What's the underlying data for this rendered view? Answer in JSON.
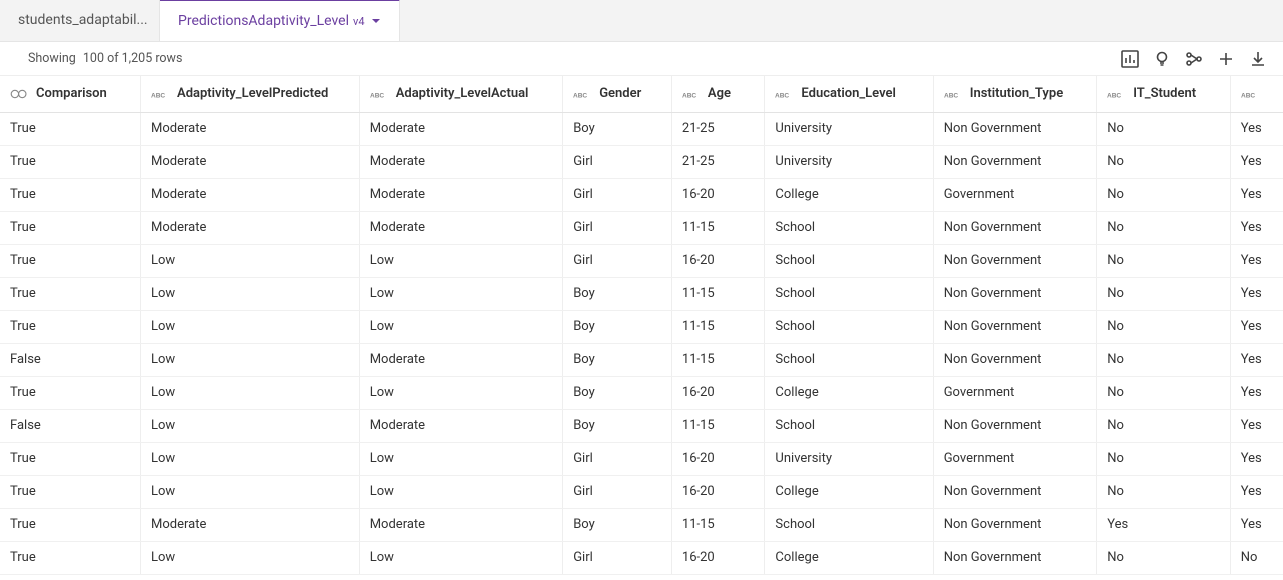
{
  "tabs": [
    {
      "label": "students_adaptabil...",
      "active": false
    },
    {
      "label": "PredictionsAdaptivity_Level",
      "version": "v4",
      "active": true
    }
  ],
  "status": {
    "showing": "Showing",
    "count": "100 of 1,205 rows"
  },
  "columns": [
    {
      "key": "Comparison",
      "label": "Comparison",
      "type": "bool"
    },
    {
      "key": "Adaptivity_LevelPredicted",
      "label": "Adaptivity_LevelPredicted",
      "type": "abc"
    },
    {
      "key": "Adaptivity_LevelActual",
      "label": "Adaptivity_LevelActual",
      "type": "abc"
    },
    {
      "key": "Gender",
      "label": "Gender",
      "type": "abc"
    },
    {
      "key": "Age",
      "label": "Age",
      "type": "abc"
    },
    {
      "key": "Education_Level",
      "label": "Education_Level",
      "type": "abc"
    },
    {
      "key": "Institution_Type",
      "label": "Institution_Type",
      "type": "abc"
    },
    {
      "key": "IT_Student",
      "label": "IT_Student",
      "type": "abc"
    },
    {
      "key": "Extra",
      "label": "",
      "type": "abc"
    }
  ],
  "rows": [
    {
      "Comparison": "True",
      "Adaptivity_LevelPredicted": "Moderate",
      "Adaptivity_LevelActual": "Moderate",
      "Gender": "Boy",
      "Age": "21-25",
      "Education_Level": "University",
      "Institution_Type": "Non Government",
      "IT_Student": "No",
      "Extra": "Yes"
    },
    {
      "Comparison": "True",
      "Adaptivity_LevelPredicted": "Moderate",
      "Adaptivity_LevelActual": "Moderate",
      "Gender": "Girl",
      "Age": "21-25",
      "Education_Level": "University",
      "Institution_Type": "Non Government",
      "IT_Student": "No",
      "Extra": "Yes"
    },
    {
      "Comparison": "True",
      "Adaptivity_LevelPredicted": "Moderate",
      "Adaptivity_LevelActual": "Moderate",
      "Gender": "Girl",
      "Age": "16-20",
      "Education_Level": "College",
      "Institution_Type": "Government",
      "IT_Student": "No",
      "Extra": "Yes"
    },
    {
      "Comparison": "True",
      "Adaptivity_LevelPredicted": "Moderate",
      "Adaptivity_LevelActual": "Moderate",
      "Gender": "Girl",
      "Age": "11-15",
      "Education_Level": "School",
      "Institution_Type": "Non Government",
      "IT_Student": "No",
      "Extra": "Yes"
    },
    {
      "Comparison": "True",
      "Adaptivity_LevelPredicted": "Low",
      "Adaptivity_LevelActual": "Low",
      "Gender": "Girl",
      "Age": "16-20",
      "Education_Level": "School",
      "Institution_Type": "Non Government",
      "IT_Student": "No",
      "Extra": "Yes"
    },
    {
      "Comparison": "True",
      "Adaptivity_LevelPredicted": "Low",
      "Adaptivity_LevelActual": "Low",
      "Gender": "Boy",
      "Age": "11-15",
      "Education_Level": "School",
      "Institution_Type": "Non Government",
      "IT_Student": "No",
      "Extra": "Yes"
    },
    {
      "Comparison": "True",
      "Adaptivity_LevelPredicted": "Low",
      "Adaptivity_LevelActual": "Low",
      "Gender": "Boy",
      "Age": "11-15",
      "Education_Level": "School",
      "Institution_Type": "Non Government",
      "IT_Student": "No",
      "Extra": "Yes"
    },
    {
      "Comparison": "False",
      "Adaptivity_LevelPredicted": "Low",
      "Adaptivity_LevelActual": "Moderate",
      "Gender": "Boy",
      "Age": "11-15",
      "Education_Level": "School",
      "Institution_Type": "Non Government",
      "IT_Student": "No",
      "Extra": "Yes"
    },
    {
      "Comparison": "True",
      "Adaptivity_LevelPredicted": "Low",
      "Adaptivity_LevelActual": "Low",
      "Gender": "Boy",
      "Age": "16-20",
      "Education_Level": "College",
      "Institution_Type": "Government",
      "IT_Student": "No",
      "Extra": "Yes"
    },
    {
      "Comparison": "False",
      "Adaptivity_LevelPredicted": "Low",
      "Adaptivity_LevelActual": "Moderate",
      "Gender": "Boy",
      "Age": "11-15",
      "Education_Level": "School",
      "Institution_Type": "Non Government",
      "IT_Student": "No",
      "Extra": "Yes"
    },
    {
      "Comparison": "True",
      "Adaptivity_LevelPredicted": "Low",
      "Adaptivity_LevelActual": "Low",
      "Gender": "Girl",
      "Age": "16-20",
      "Education_Level": "University",
      "Institution_Type": "Government",
      "IT_Student": "No",
      "Extra": "Yes"
    },
    {
      "Comparison": "True",
      "Adaptivity_LevelPredicted": "Low",
      "Adaptivity_LevelActual": "Low",
      "Gender": "Girl",
      "Age": "16-20",
      "Education_Level": "College",
      "Institution_Type": "Non Government",
      "IT_Student": "No",
      "Extra": "Yes"
    },
    {
      "Comparison": "True",
      "Adaptivity_LevelPredicted": "Moderate",
      "Adaptivity_LevelActual": "Moderate",
      "Gender": "Boy",
      "Age": "11-15",
      "Education_Level": "School",
      "Institution_Type": "Non Government",
      "IT_Student": "Yes",
      "Extra": "Yes"
    },
    {
      "Comparison": "True",
      "Adaptivity_LevelPredicted": "Low",
      "Adaptivity_LevelActual": "Low",
      "Gender": "Girl",
      "Age": "16-20",
      "Education_Level": "College",
      "Institution_Type": "Non Government",
      "IT_Student": "No",
      "Extra": "No"
    }
  ]
}
